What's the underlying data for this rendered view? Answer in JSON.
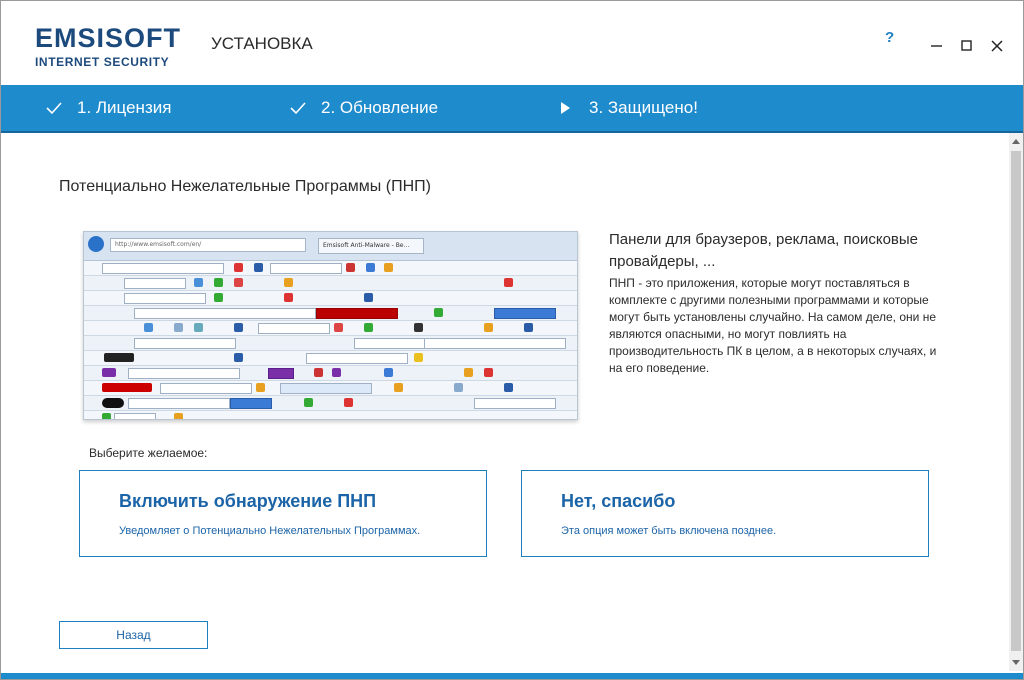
{
  "app": {
    "logo_main": "EMSISOFT",
    "logo_sub": "INTERNET SECURITY",
    "window_title": "УСТАНОВКА",
    "help": "?"
  },
  "steps": [
    {
      "label": "1. Лицензия",
      "state": "done",
      "icon": "check-icon"
    },
    {
      "label": "2. Обновление",
      "state": "done",
      "icon": "check-icon"
    },
    {
      "label": "3. Защищено!",
      "state": "current",
      "icon": "play-icon"
    }
  ],
  "main": {
    "heading": "Потенциально Нежелательные Программы (ПНП)",
    "screenshot": {
      "address": "http://www.emsisoft.com/en/",
      "tab": "Emsisoft Anti-Malware - Be..."
    },
    "desc_title": "Панели для браузеров, реклама, поисковые провайдеры, ...",
    "desc_body": "ПНП - это приложения, которые могут поставляться в комплекте с другими полезными программами и которые могут быть установлены случайно. На самом деле, они не являются опасными, но могут повлиять на производительность ПК в целом, а в некоторых случаях, и на его поведение.",
    "choose_label": "Выберите желаемое:",
    "option_enable": {
      "title": "Включить обнаружение ПНП",
      "subtitle": "Уведомляет о Потенциально Нежелательных Программах."
    },
    "option_decline": {
      "title": "Нет, спасибо",
      "subtitle": "Эта опция может быть включена позднее."
    },
    "back_button": "Назад"
  },
  "colors": {
    "brand": "#1d4a7d",
    "steps_bar": "#1e8bcd",
    "accent_text": "#1c64a8"
  }
}
